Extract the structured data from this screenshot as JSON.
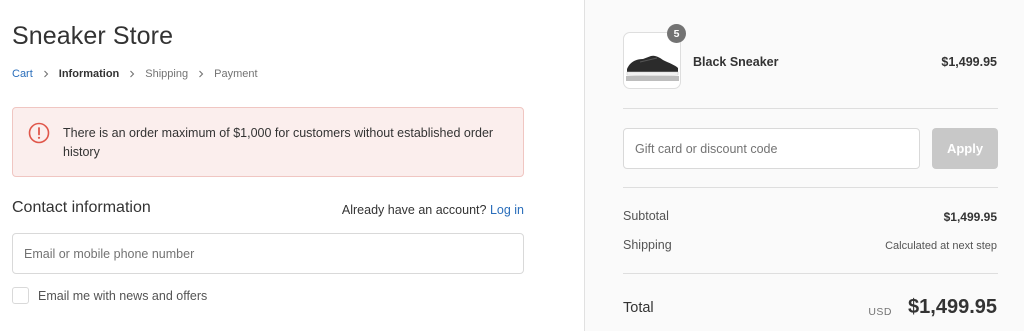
{
  "store": {
    "title": "Sneaker Store"
  },
  "breadcrumb": {
    "items": [
      {
        "label": "Cart",
        "state": "link"
      },
      {
        "label": "Information",
        "state": "current"
      },
      {
        "label": "Shipping",
        "state": "upcoming"
      },
      {
        "label": "Payment",
        "state": "upcoming"
      }
    ],
    "separator_icon": "chevron-right-icon"
  },
  "notice": {
    "icon": "alert-circle-icon",
    "text": "There is an order maximum of $1,000 for customers without established order history",
    "colors": {
      "background": "#fbeeed",
      "border": "#f0c6c2",
      "icon": "#e0564a"
    }
  },
  "contact": {
    "title": "Contact information",
    "account_prompt": "Already have an account?",
    "login_label": "Log in",
    "email_placeholder": "Email or mobile phone number",
    "email_value": "",
    "newsletter_label": "Email me with news and offers",
    "newsletter_checked": false
  },
  "summary": {
    "product": {
      "name": "Black Sneaker",
      "price": "$1,499.95",
      "quantity": "5",
      "image_icon": "sneaker-image"
    },
    "discount": {
      "placeholder": "Gift card or discount code",
      "value": "",
      "apply_label": "Apply"
    },
    "subtotal_label": "Subtotal",
    "subtotal_value": "$1,499.95",
    "shipping_label": "Shipping",
    "shipping_value": "Calculated at next step",
    "total_label": "Total",
    "total_currency": "USD",
    "total_value": "$1,499.95"
  },
  "colors": {
    "link": "#2a6ebb",
    "apply_button": "#c8c8c8",
    "sidebar_background": "#fafafa"
  }
}
